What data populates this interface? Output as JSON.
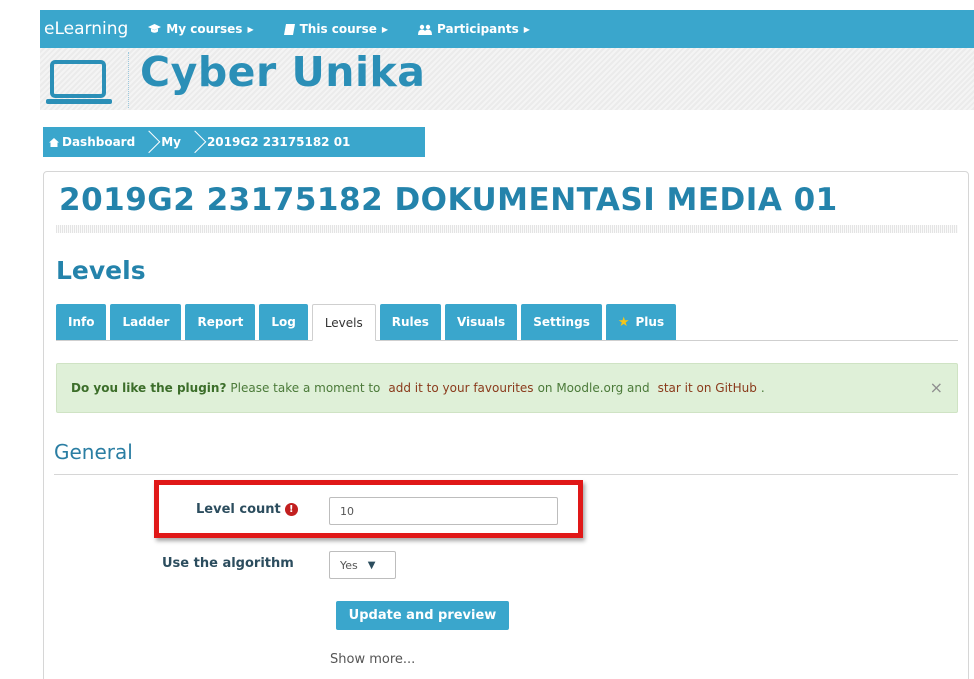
{
  "topnav": {
    "brand": "eLearning",
    "items": [
      {
        "label": "My courses",
        "icon": "graduation-cap-icon"
      },
      {
        "label": "This course",
        "icon": "book-icon"
      },
      {
        "label": "Participants",
        "icon": "users-icon"
      }
    ]
  },
  "header": {
    "site_name": "Cyber Unika"
  },
  "breadcrumb": [
    "Dashboard",
    "My",
    "2019G2 23175182 01"
  ],
  "course": {
    "title": "2019G2 23175182 DOKUMENTASI MEDIA 01",
    "section": "Levels"
  },
  "tabs": [
    "Info",
    "Ladder",
    "Report",
    "Log",
    "Levels",
    "Rules",
    "Visuals",
    "Settings",
    "Plus"
  ],
  "active_tab": "Levels",
  "alert": {
    "bold": "Do you like the plugin?",
    "text1": "Please take a moment to",
    "link1": "add it to your favourites",
    "text2": "on Moodle.org and",
    "link2": "star it on GitHub",
    "text3": ".",
    "close": "×"
  },
  "form": {
    "section": "General",
    "level_count_label": "Level count",
    "level_count_value": "10",
    "algorithm_label": "Use the algorithm",
    "algorithm_value": "Yes",
    "submit": "Update and preview",
    "show_more": "Show more..."
  },
  "colors": {
    "accent": "#3aa6cc",
    "title": "#2483ab",
    "alert_bg": "#dff0d8",
    "highlight": "#e01818"
  }
}
